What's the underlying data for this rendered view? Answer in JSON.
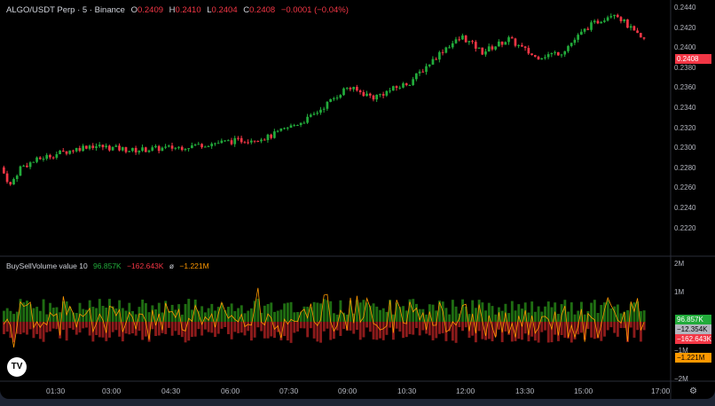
{
  "header": {
    "symbol": "ALGO/USDT Perp · 5 · Binance",
    "o_label": "O",
    "o": "0.2409",
    "h_label": "H",
    "h": "0.2410",
    "l_label": "L",
    "l": "0.2404",
    "c_label": "C",
    "c": "0.2408",
    "change": "−0.0001 (−0.04%)"
  },
  "price_axis": [
    "0.2440",
    "0.2420",
    "0.2400",
    "0.2380",
    "0.2360",
    "0.2340",
    "0.2320",
    "0.2300",
    "0.2280",
    "0.2260",
    "0.2240",
    "0.2220"
  ],
  "last_price": "0.2408",
  "indicator": {
    "name": "BuySellVolume value 10",
    "buy": "96.857K",
    "sell": "−162.643K",
    "avg_symbol": "ø",
    "avg": "−1.221M"
  },
  "volume_axis": [
    "2M",
    "1M",
    "−1M",
    "−2M"
  ],
  "volume_tags": {
    "buy": "96.857K",
    "net": "−12.354K",
    "sell": "−162.643K",
    "avg": "−1.221M"
  },
  "time_axis": [
    "01:30",
    "03:00",
    "04:30",
    "06:00",
    "07:30",
    "09:00",
    "10:30",
    "12:00",
    "13:30",
    "15:00",
    "17:00"
  ],
  "colors": {
    "up": "#22ab3b",
    "down": "#f23645",
    "vol_up": "#1f6d12",
    "vol_down": "#8c1b1b",
    "avg": "#ff9800"
  },
  "chart_data": {
    "type": "candlestick",
    "price_path": [
      [
        0,
        0.228
      ],
      [
        3,
        0.2262
      ],
      [
        6,
        0.228
      ],
      [
        13,
        0.229
      ],
      [
        27,
        0.2302
      ],
      [
        40,
        0.2297
      ],
      [
        54,
        0.23
      ],
      [
        67,
        0.2305
      ],
      [
        81,
        0.231
      ],
      [
        94,
        0.233
      ],
      [
        105,
        0.236
      ],
      [
        113,
        0.235
      ],
      [
        124,
        0.2365
      ],
      [
        135,
        0.24
      ],
      [
        140,
        0.241
      ],
      [
        146,
        0.2395
      ],
      [
        154,
        0.2408
      ],
      [
        162,
        0.239
      ],
      [
        170,
        0.2395
      ],
      [
        178,
        0.242
      ],
      [
        186,
        0.2435
      ],
      [
        194,
        0.2408
      ]
    ]
  },
  "logo": "TV",
  "settings_icon": "gear-icon"
}
